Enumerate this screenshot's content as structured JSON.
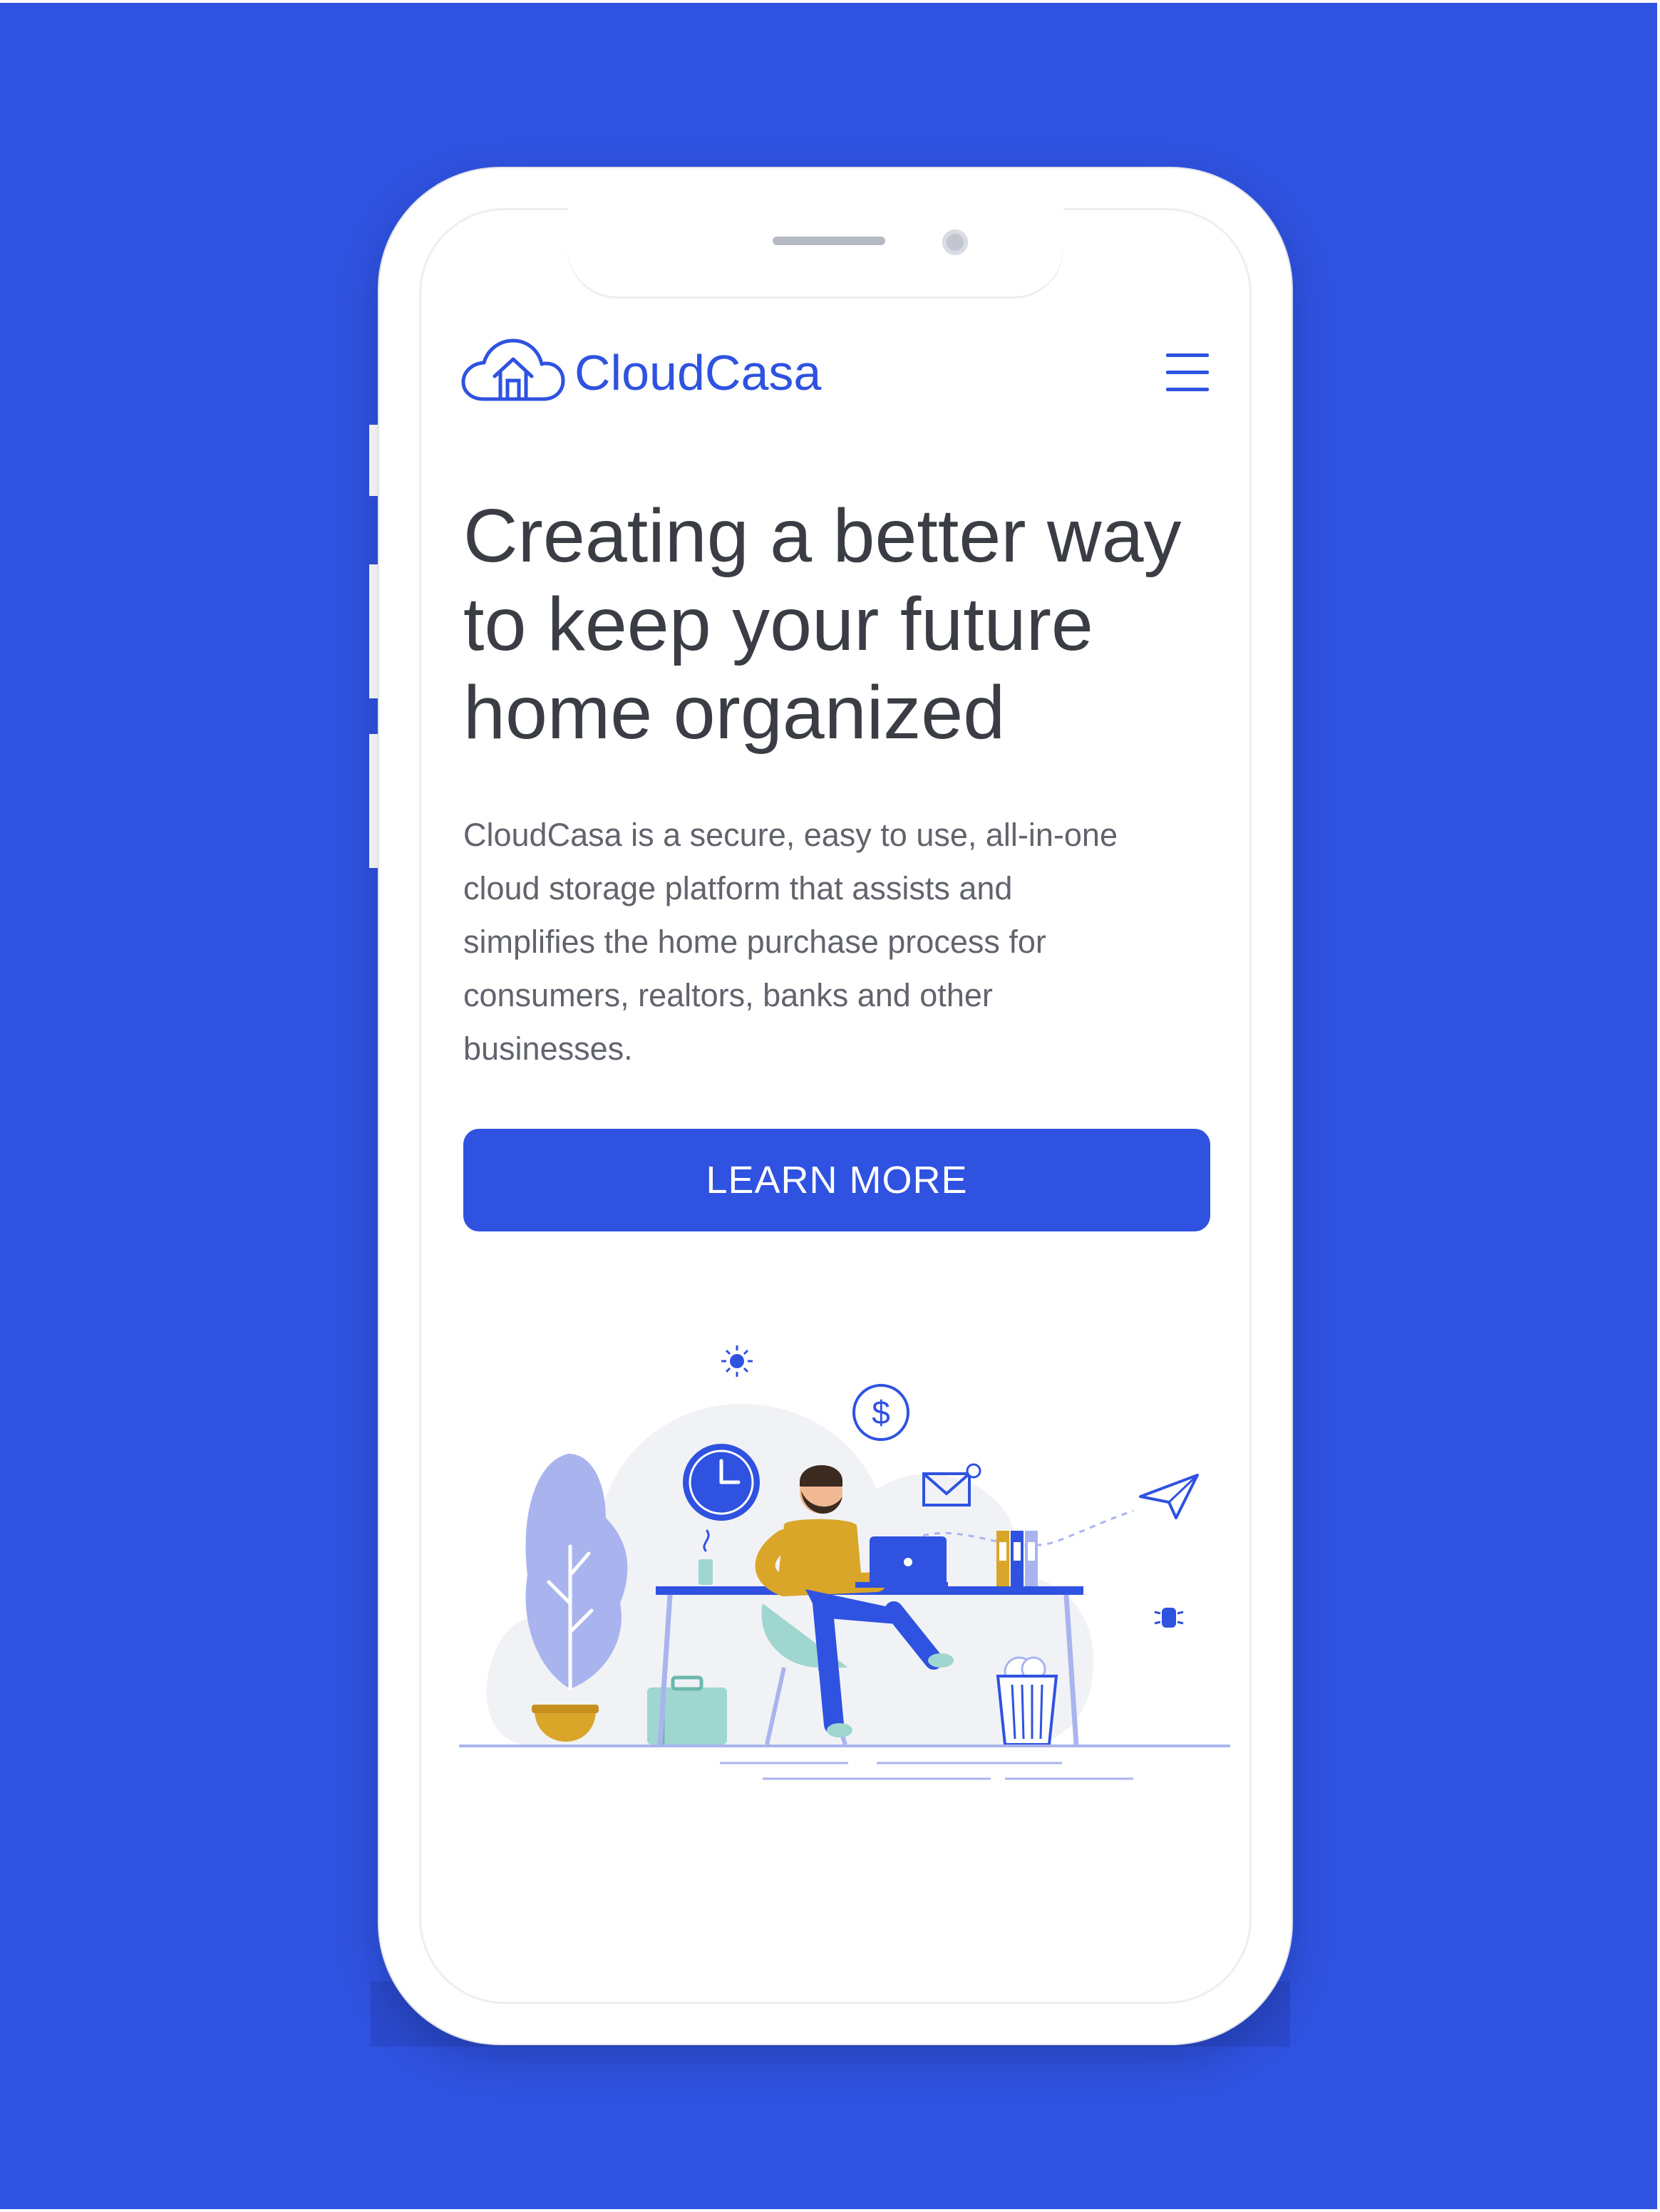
{
  "brand": {
    "name": "CloudCasa",
    "color": "#2f52e0"
  },
  "nav": {
    "menu_icon": "hamburger-menu-icon"
  },
  "hero": {
    "headline_line1": "Creating a better way",
    "headline_line2": "to keep your future",
    "headline_line3": "home organized",
    "description_line1": "CloudCasa is a secure, easy to use, all-in-one",
    "description_line2": "cloud storage platform that assists and",
    "description_line3": "simplifies the home purchase process for",
    "description_line4": "consumers, realtors, banks and other",
    "description_line5": "businesses.",
    "cta_label": "LEARN MORE"
  },
  "illustration": {
    "subject": "person-working-at-desk-illustration",
    "icons": [
      "sun-icon",
      "dollar-coin-icon",
      "clock-icon",
      "envelope-icon",
      "paper-plane-icon",
      "plant-icon",
      "laptop-icon",
      "folders-icon",
      "trash-bin-icon",
      "briefcase-icon",
      "coffee-cup-icon"
    ]
  },
  "colors": {
    "background": "#2f52e0",
    "device": "#ffffff",
    "text_dark": "#3a3d44",
    "text_body": "#61646c",
    "accent_yellow": "#d9a62a",
    "accent_lavender": "#a9b4ef",
    "accent_teal": "#9fd6cf"
  }
}
